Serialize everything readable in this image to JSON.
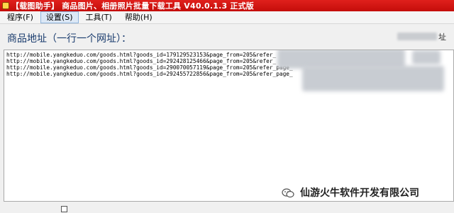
{
  "window": {
    "title": "【载图助手】 商品图片、相册照片批量下载工具 V40.0.1.3 正式版"
  },
  "menu": {
    "items": [
      {
        "label": "程序(F)"
      },
      {
        "label": "设置(S)"
      },
      {
        "label": "工具(T)"
      },
      {
        "label": "帮助(H)"
      }
    ]
  },
  "main": {
    "heading": "商品地址（一行一个网址）：",
    "right_label": "址",
    "urls": [
      "http://mobile.yangkeduo.com/goods.html?goods_id=179129523153&page_from=205&refer_",
      "http://mobile.yangkeduo.com/goods.html?goods_id=292428125466&page_from=205&refer_",
      "http://mobile.yangkeduo.com/goods.html?goods_id=290070057119&page_from=205&refer_page_",
      "http://mobile.yangkeduo.com/goods.html?goods_id=292455722856&page_from=205&refer_page_"
    ]
  },
  "watermark": {
    "text": "仙游火牛软件开发有限公司",
    "icon": "wechat-icon"
  },
  "colors": {
    "titlebar": "#d4140f",
    "heading": "#1a3c6e"
  }
}
